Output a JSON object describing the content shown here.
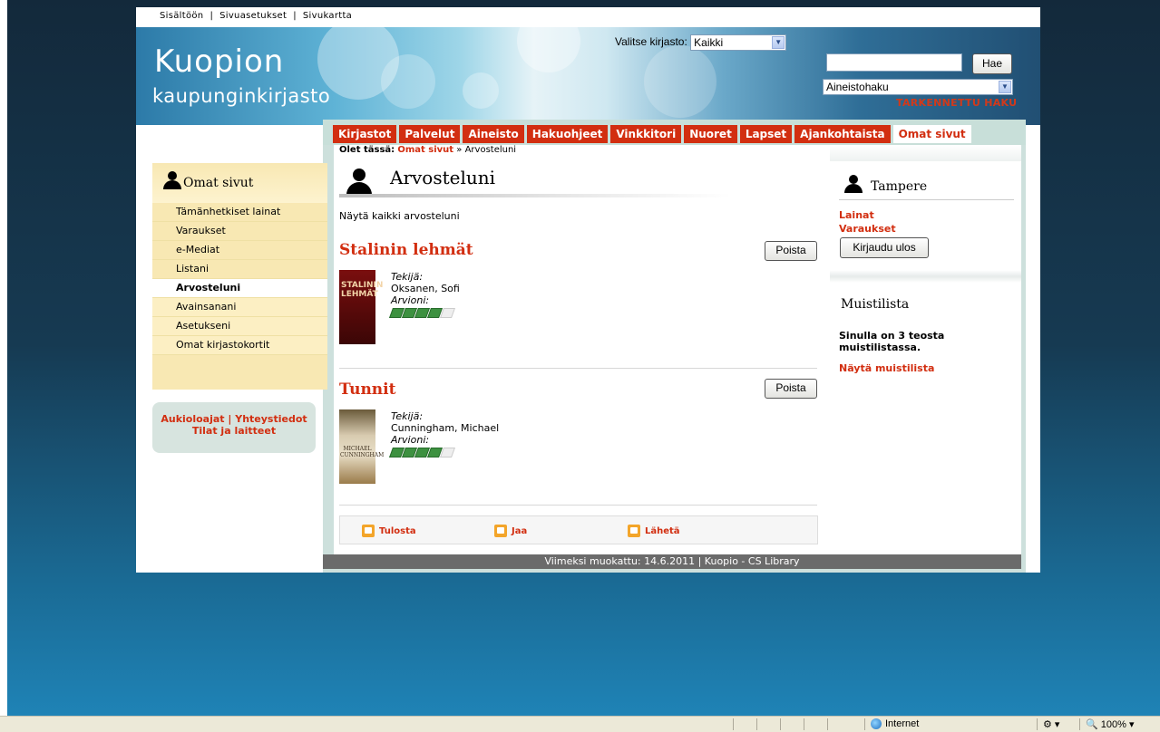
{
  "toplinks": [
    "Sisältöön",
    "Sivuasetukset",
    "Sivukartta"
  ],
  "logo": {
    "line1": "Kuopion",
    "line2": "kaupunginkirjasto"
  },
  "library_select": {
    "label": "Valitse kirjasto:",
    "value": "Kaikki"
  },
  "search": {
    "button": "Hae",
    "type_value": "Aineistohaku",
    "advanced": "TARKENNETTU HAKU"
  },
  "nav": [
    "Kirjastot",
    "Palvelut",
    "Aineisto",
    "Hakuohjeet",
    "Vinkkitori",
    "Nuoret",
    "Lapset",
    "Ajankohtaista",
    "Omat sivut"
  ],
  "breadcrumb": {
    "prefix": "Olet tässä:",
    "link": "Omat sivut",
    "sep": "»",
    "current": "Arvosteluni"
  },
  "page_title": "Arvosteluni",
  "show_all": "Näytä kaikki arvosteluni",
  "reviews": [
    {
      "title": "Stalinin lehmät",
      "delete": "Poista",
      "author_label": "Tekijä:",
      "author": "Oksanen, Sofi",
      "rating_label": "Arvioni:",
      "rating": 4,
      "max": 5,
      "cover_text": "STALININ LEHMÄT"
    },
    {
      "title": "Tunnit",
      "delete": "Poista",
      "author_label": "Tekijä:",
      "author": "Cunningham, Michael",
      "rating_label": "Arvioni:",
      "rating": 4,
      "max": 5,
      "cover_text": "MICHAEL CUNNINGHAM"
    }
  ],
  "actions": [
    "Tulosta",
    "Jaa",
    "Lähetä"
  ],
  "footer": "Viimeksi muokattu: 14.6.2011 | Kuopio - CS Library",
  "sidebar": {
    "title": "Omat sivut",
    "items": [
      "Tämänhetkiset lainat",
      "Varaukset",
      "e-Mediat",
      "Listani",
      "Arvosteluni",
      "Avainsanani",
      "Asetukseni",
      "Omat kirjastokortit"
    ],
    "active_index": 4,
    "info": {
      "line1": "Aukioloajat | Yhteystiedot",
      "line2": "Tilat ja laitteet"
    }
  },
  "right": {
    "user": "Tampere",
    "links": [
      "Lainat",
      "Varaukset"
    ],
    "logout": "Kirjaudu ulos",
    "memo_title": "Muistilista",
    "memo_text": "Sinulla on 3 teosta muistilistassa.",
    "memo_link": "Näytä muistilista"
  },
  "statusbar": {
    "zone": "Internet",
    "zoom": "100%"
  },
  "colors": {
    "accent": "#d22e10",
    "sidebar_bg": "#f8e8b3",
    "footer_bg": "#6b6b6b"
  }
}
